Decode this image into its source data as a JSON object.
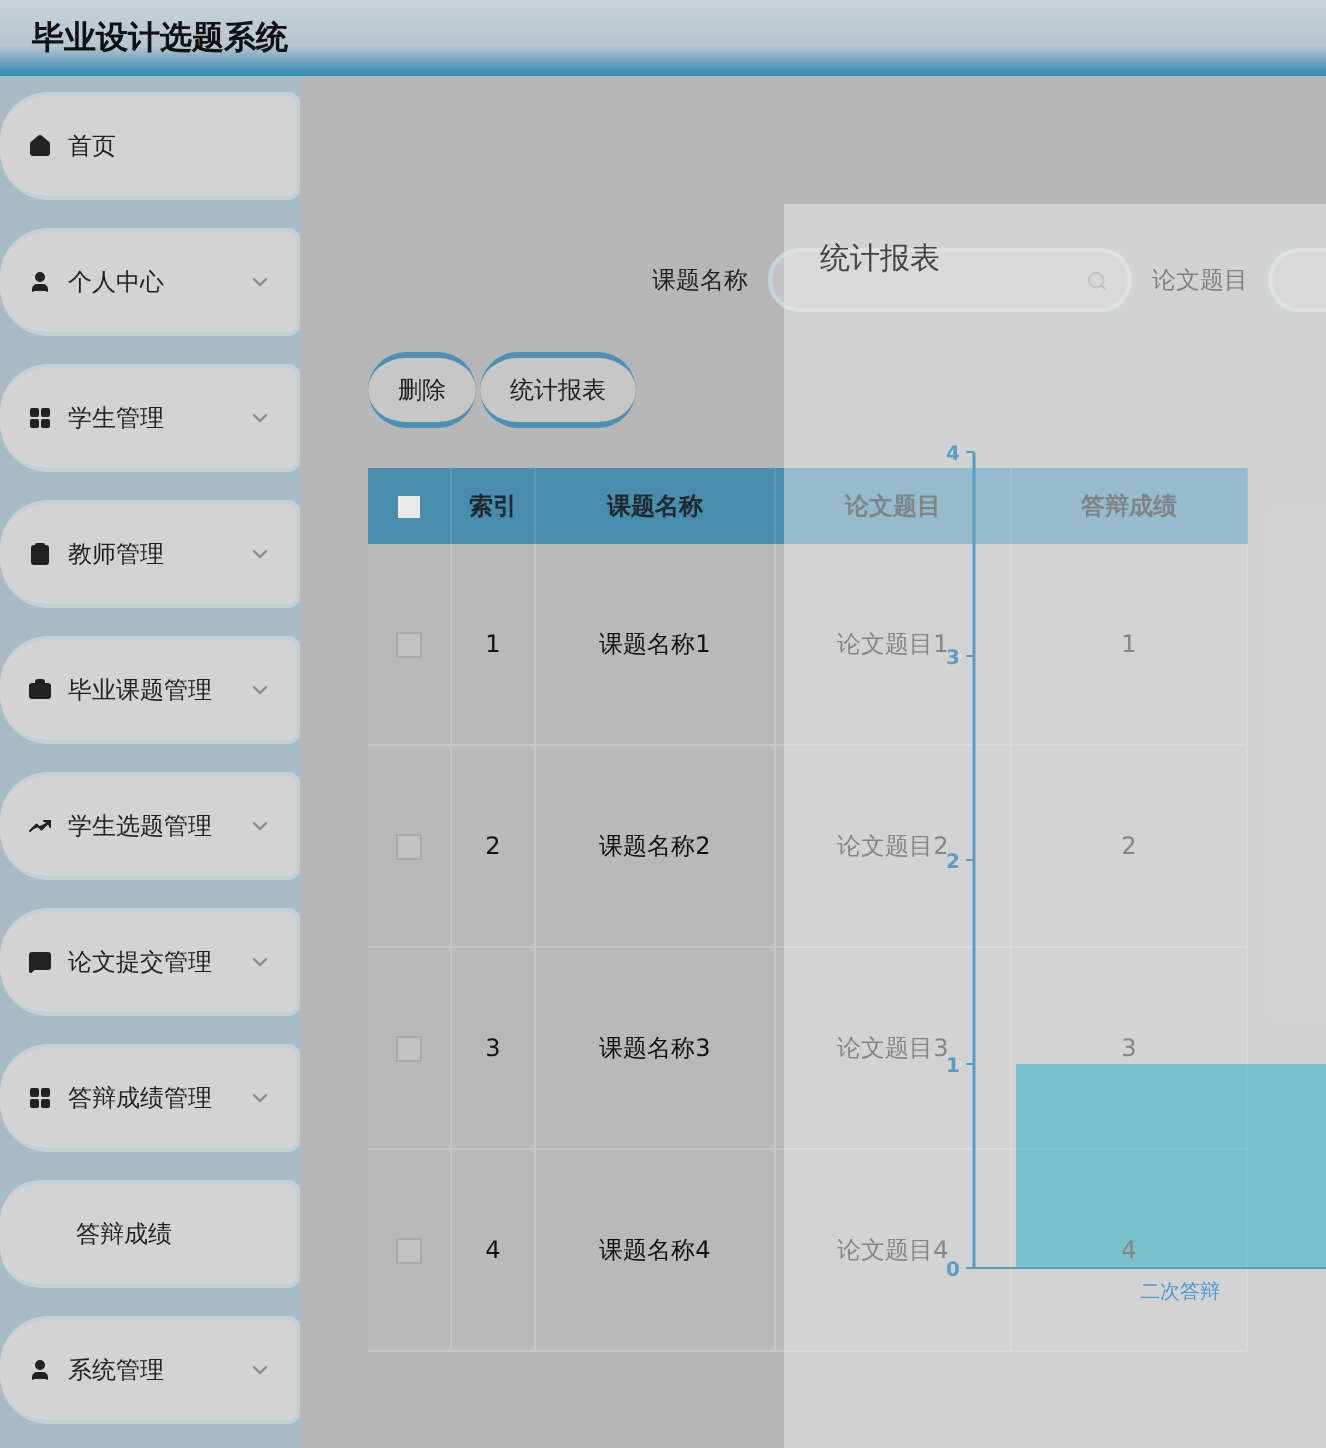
{
  "header": {
    "title": "毕业设计选题系统"
  },
  "sidebar": {
    "items": [
      {
        "label": "首页",
        "kind": "link"
      },
      {
        "label": "个人中心",
        "kind": "menu"
      },
      {
        "label": "学生管理",
        "kind": "menu"
      },
      {
        "label": "教师管理",
        "kind": "menu"
      },
      {
        "label": "毕业课题管理",
        "kind": "menu"
      },
      {
        "label": "学生选题管理",
        "kind": "menu"
      },
      {
        "label": "论文提交管理",
        "kind": "menu"
      },
      {
        "label": "答辩成绩管理",
        "kind": "menu",
        "children": [
          {
            "label": "答辩成绩"
          }
        ]
      },
      {
        "label": "系统管理",
        "kind": "menu"
      }
    ]
  },
  "search": {
    "fields": [
      {
        "label": "课题名称"
      },
      {
        "label": "论文题目"
      }
    ]
  },
  "actions": [
    "删除",
    "统计报表"
  ],
  "table": {
    "all_selected": false,
    "columns": [
      "索引",
      "课题名称",
      "论文题目",
      "答辩成绩"
    ],
    "rows": [
      {
        "selected": false,
        "cells": [
          "1",
          "课题名称1",
          "论文题目1",
          "1"
        ]
      },
      {
        "selected": false,
        "cells": [
          "2",
          "课题名称2",
          "论文题目2",
          "2"
        ]
      },
      {
        "selected": false,
        "cells": [
          "3",
          "课题名称3",
          "论文题目3",
          "3"
        ]
      },
      {
        "selected": false,
        "cells": [
          "4",
          "课题名称4",
          "论文题目4",
          "4"
        ]
      }
    ]
  },
  "modal": {
    "title": "统计报表",
    "chart_data": {
      "type": "bar",
      "categories": [
        "二次答辩"
      ],
      "values": [
        1
      ],
      "ylim": [
        0,
        4
      ],
      "yticks": [
        0,
        1,
        2,
        3,
        4
      ]
    }
  }
}
